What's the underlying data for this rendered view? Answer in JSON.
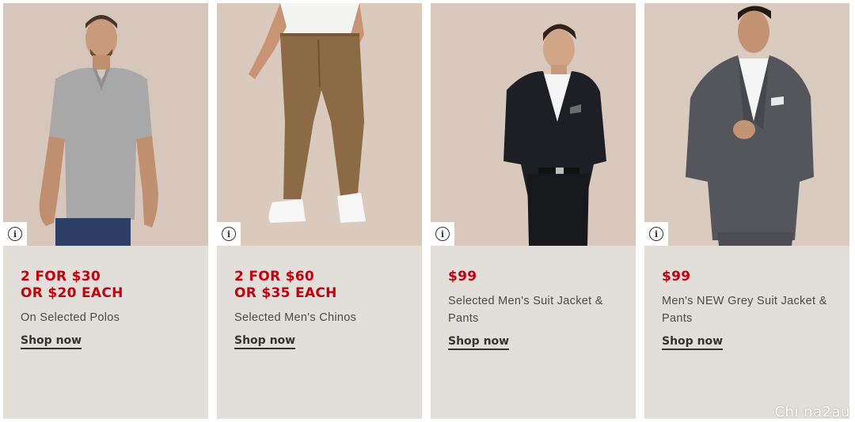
{
  "colors": {
    "card_bg": "#e2dfda",
    "photo_bg": "#d9c9bf",
    "price": "#c4000e",
    "text": "#4a4a4a",
    "link": "#333333"
  },
  "cards": [
    {
      "price_line1": "2 FOR $30",
      "price_line2": "OR $20 EACH",
      "description": "On Selected Polos",
      "cta": "Shop now",
      "image_icon": "info-icon",
      "image_subject": "man-in-grey-polo"
    },
    {
      "price_line1": "2 FOR $60",
      "price_line2": "OR $35 EACH",
      "description": "Selected Men's Chinos",
      "cta": "Shop now",
      "image_icon": "info-icon",
      "image_subject": "man-in-brown-chinos"
    },
    {
      "price_line1": "$99",
      "price_line2": "",
      "description": "Selected Men's Suit Jacket & Pants",
      "cta": "Shop now",
      "image_icon": "info-icon",
      "image_subject": "man-in-black-suit"
    },
    {
      "price_line1": "$99",
      "price_line2": "",
      "description": "Men's NEW Grey Suit Jacket & Pants",
      "cta": "Shop now",
      "image_icon": "info-icon",
      "image_subject": "man-in-grey-suit"
    }
  ],
  "watermark": "Chi na2au"
}
